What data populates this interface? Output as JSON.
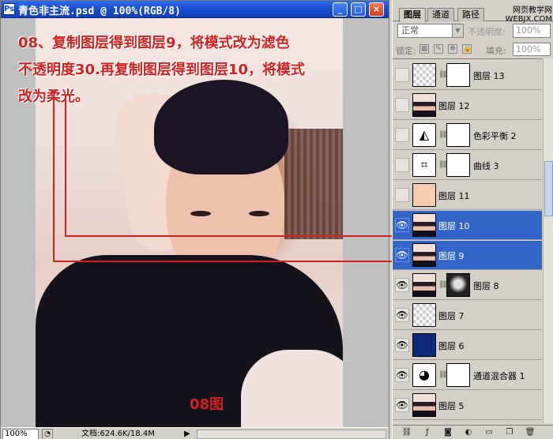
{
  "window": {
    "title": "青色非主流.psd @ 100%(RGB/8)",
    "doc_icon": "ps-document-icon",
    "minimize": "_",
    "maximize": "□",
    "close": "×"
  },
  "annotation": {
    "line1": "08、复制图层得到图层9，将模式改为滤色",
    "line2": "不透明度30.再复制图层得到图层10，将模式",
    "line3": "改为柔光。",
    "figure_label": "08图",
    "color": "#d0231f"
  },
  "status_bar": {
    "zoom": "100%",
    "doc_size": "文档:624.6K/18.4M",
    "arrow": "▶"
  },
  "panel": {
    "tabs": [
      "图层",
      "通道",
      "路径"
    ],
    "watermark_line1": "网页教学网",
    "watermark_line2": "WEBJX.COM",
    "blend_mode": "正常",
    "opacity_label": "不透明度:",
    "opacity_value": "100%",
    "lock_label": "锁定:",
    "fill_label": "填充:",
    "fill_value": "100%"
  },
  "layers": [
    {
      "name": "图层 13",
      "visible": false,
      "thumb": "check",
      "mask": "white",
      "selected": false
    },
    {
      "name": "图层 12",
      "visible": false,
      "thumb": "portrait",
      "mask": null,
      "selected": false
    },
    {
      "name": "色彩平衡 2",
      "visible": false,
      "thumb": "adjust-balance",
      "mask": "white",
      "selected": false
    },
    {
      "name": "曲线 3",
      "visible": false,
      "thumb": "adjust-curves",
      "mask": "white",
      "selected": false
    },
    {
      "name": "图层 11",
      "visible": false,
      "thumb": "skin-fill",
      "mask": null,
      "selected": false
    },
    {
      "name": "图层 10",
      "visible": true,
      "thumb": "portrait",
      "mask": null,
      "selected": true
    },
    {
      "name": "图层 9",
      "visible": true,
      "thumb": "portrait",
      "mask": null,
      "selected": true
    },
    {
      "name": "图层 8",
      "visible": true,
      "thumb": "portrait",
      "mask": "dark",
      "selected": false
    },
    {
      "name": "图层 7",
      "visible": true,
      "thumb": "check",
      "mask": null,
      "selected": false
    },
    {
      "name": "图层 6",
      "visible": true,
      "thumb": "navy-fill",
      "mask": null,
      "selected": false
    },
    {
      "name": "通道混合器 1",
      "visible": true,
      "thumb": "adjust-mixer",
      "mask": "white",
      "selected": false
    },
    {
      "name": "图层 5",
      "visible": true,
      "thumb": "portrait",
      "mask": null,
      "selected": false
    }
  ],
  "footer_icons": [
    "link-icon",
    "fx-icon",
    "mask-icon",
    "adjustment-icon",
    "folder-icon",
    "new-layer-icon",
    "trash-icon"
  ]
}
